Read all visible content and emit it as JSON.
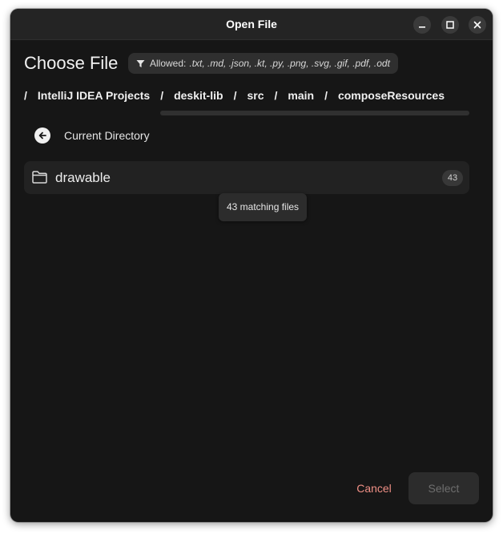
{
  "window": {
    "title": "Open File"
  },
  "titlebar_buttons": {
    "minimize": "minimize-icon",
    "maximize": "maximize-icon",
    "close": "close-icon"
  },
  "header": {
    "heading": "Choose File",
    "filter_label": "Allowed:",
    "filter_extensions": ".txt, .md, .json, .kt, .py, .png, .svg, .gif, .pdf, .odt",
    "filter_icon": "filter-icon"
  },
  "breadcrumb": {
    "separator": "/",
    "items": [
      "IntelliJ IDEA Projects",
      "deskit-lib",
      "src",
      "main",
      "composeResources"
    ]
  },
  "current_directory": {
    "label": "Current Directory",
    "icon": "back-arrow-icon"
  },
  "entries": [
    {
      "name": "drawable",
      "count": "43",
      "icon": "folder-icon",
      "tooltip": "43 matching files"
    }
  ],
  "actions": {
    "cancel": "Cancel",
    "select": "Select"
  },
  "colors": {
    "accent_cancel": "#ef8f85",
    "window_bg": "#161616",
    "titlebar_bg": "#242424"
  }
}
